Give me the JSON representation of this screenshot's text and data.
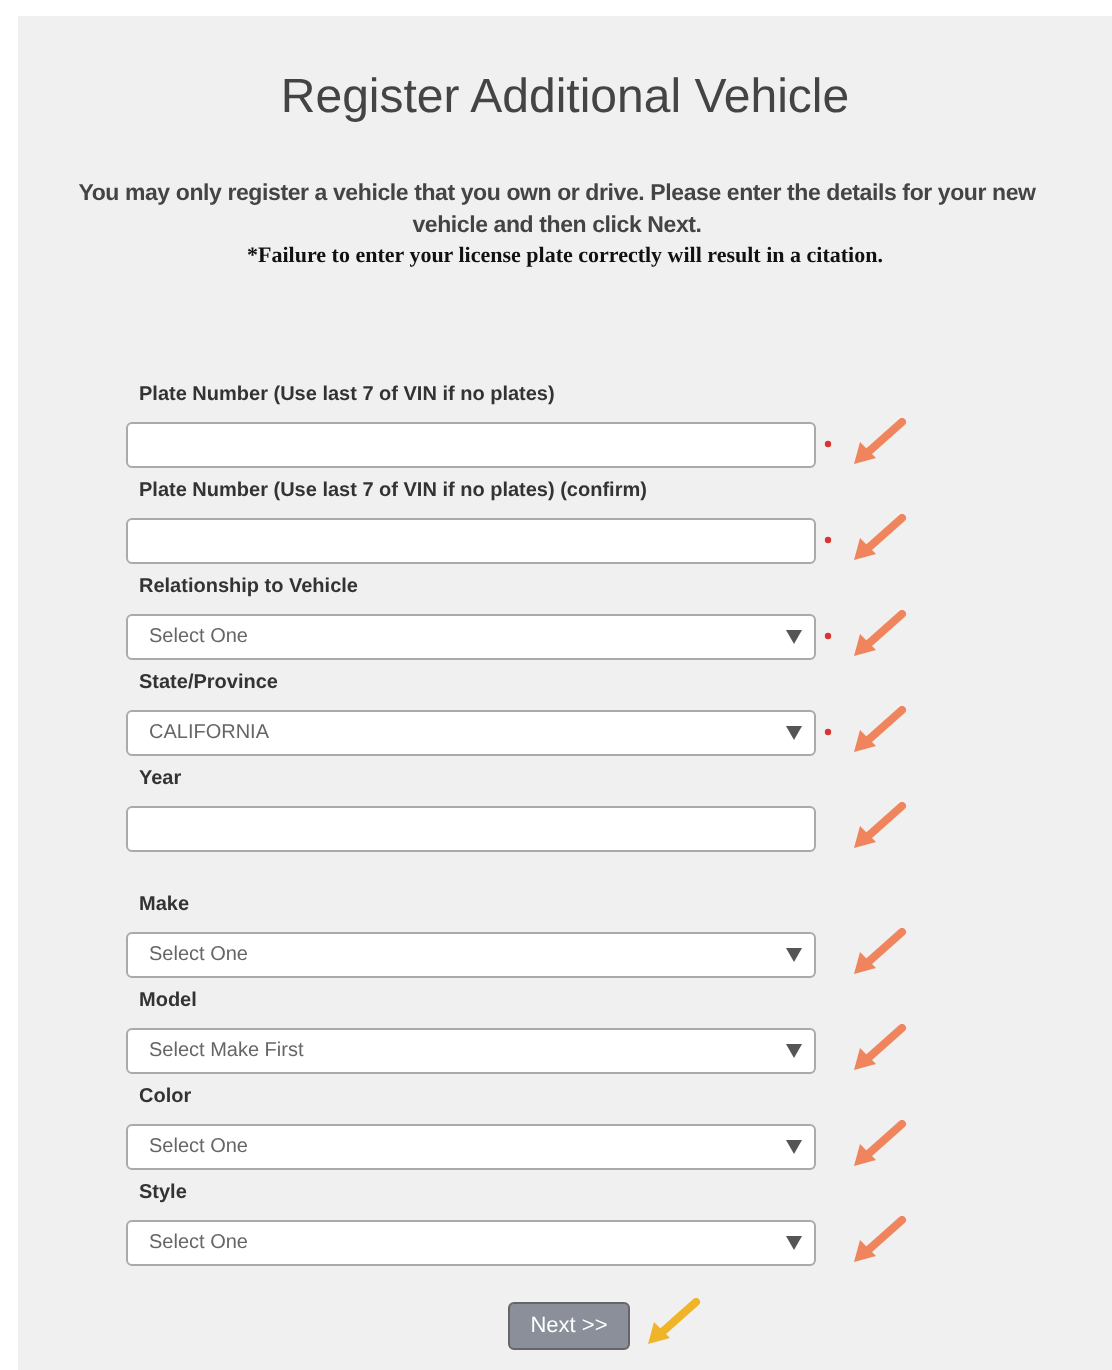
{
  "title": "Register Additional Vehicle",
  "intro": "You may only register a vehicle that you own or drive. Please enter the details for your new vehicle and then click Next.",
  "warning": "*Failure to enter your license plate correctly will result in a citation.",
  "fields": [
    {
      "label": "Plate Number (Use last 7 of VIN if no plates)",
      "kind": "text",
      "required": true
    },
    {
      "label": "Plate Number (Use last 7 of VIN if no plates) (confirm)",
      "kind": "text",
      "required": true
    },
    {
      "label": "Relationship to Vehicle",
      "kind": "select",
      "value": "Select One",
      "required": true
    },
    {
      "label": "State/Province",
      "kind": "select",
      "value": "CALIFORNIA",
      "required": true
    },
    {
      "label": "Year",
      "kind": "text",
      "required": false
    },
    {
      "label": "Make",
      "kind": "select",
      "value": "Select One",
      "required": false
    },
    {
      "label": "Model",
      "kind": "select",
      "value": "Select Make First",
      "required": false
    },
    {
      "label": "Color",
      "kind": "select",
      "value": "Select One",
      "required": false
    },
    {
      "label": "Style",
      "kind": "select",
      "value": "Select One",
      "required": false
    }
  ],
  "next_button": "Next >>"
}
